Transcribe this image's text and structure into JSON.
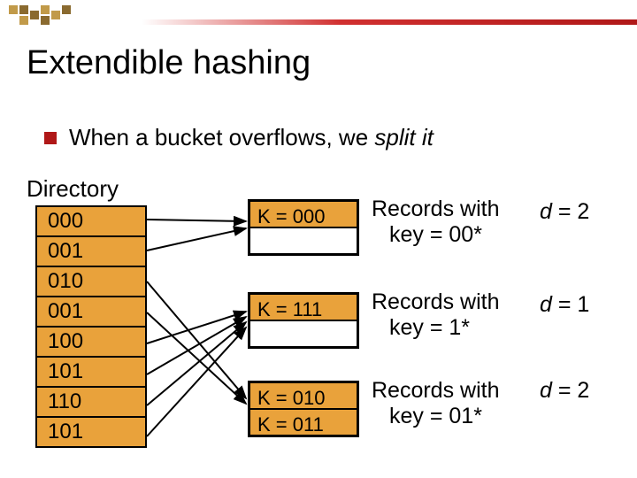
{
  "title": "Extendible hashing",
  "bullet": {
    "pre": "When a bucket overflows, we ",
    "em": "split it"
  },
  "directory_label": "Directory",
  "directory": [
    "000",
    "001",
    "010",
    "001",
    "100",
    "101",
    "110",
    "101"
  ],
  "buckets": [
    {
      "rows": [
        "K = 000",
        ""
      ],
      "note_lines": [
        "Records with",
        "key = 00*"
      ],
      "depth": "2"
    },
    {
      "rows": [
        "K = 111",
        ""
      ],
      "note_lines": [
        "Records with",
        "key = 1*"
      ],
      "depth": "1"
    },
    {
      "rows": [
        "K = 010",
        "K = 011"
      ],
      "note_lines": [
        "Records with",
        "key = 01*"
      ],
      "depth": "2"
    }
  ],
  "depth_var": "d"
}
